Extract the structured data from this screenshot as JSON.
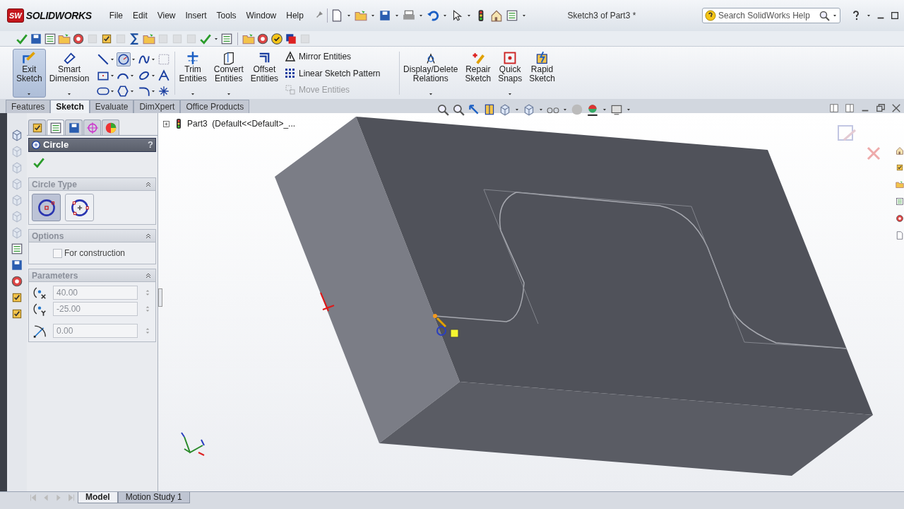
{
  "app": {
    "badge": "SW",
    "name": "SOLIDWORKS"
  },
  "menu": [
    "File",
    "Edit",
    "View",
    "Insert",
    "Tools",
    "Window",
    "Help"
  ],
  "window": {
    "title": "Sketch3 of Part3 *"
  },
  "search": {
    "placeholder": "Search SolidWorks Help"
  },
  "sketch_commands": [
    {
      "label": "Exit Sketch",
      "selected": true
    },
    {
      "label": "Smart Dimension",
      "selected": false
    }
  ],
  "edit_commands": [
    {
      "label": "Trim Entities"
    },
    {
      "label": "Convert Entities"
    },
    {
      "label": "Offset Entities"
    }
  ],
  "pattern_commands": [
    {
      "label": "Mirror Entities",
      "disabled": false
    },
    {
      "label": "Linear Sketch Pattern",
      "disabled": false
    },
    {
      "label": "Move Entities",
      "disabled": true
    }
  ],
  "relation_commands": [
    {
      "label": "Display/Delete Relations"
    },
    {
      "label": "Repair Sketch"
    },
    {
      "label": "Quick Snaps"
    },
    {
      "label": "Rapid Sketch"
    }
  ],
  "command_tabs": [
    {
      "label": "Features",
      "selected": false
    },
    {
      "label": "Sketch",
      "selected": true
    },
    {
      "label": "Evaluate",
      "selected": false
    },
    {
      "label": "DimXpert",
      "selected": false
    },
    {
      "label": "Office Products",
      "selected": false
    }
  ],
  "feature_tree": {
    "root": "Part3  (Default<<Default>_..."
  },
  "property_manager": {
    "title": "Circle",
    "help": "?",
    "circle_type": {
      "title": "Circle Type",
      "options": [
        {
          "kind": "center",
          "selected": true
        },
        {
          "kind": "perimeter",
          "selected": false
        }
      ]
    },
    "options": {
      "title": "Options",
      "for_construction": {
        "label": "For construction",
        "checked": false
      }
    },
    "parameters": {
      "title": "Parameters",
      "fields": [
        {
          "kind": "center-x",
          "value": "40.00"
        },
        {
          "kind": "center-y",
          "value": "-25.00"
        },
        {
          "kind": "radius",
          "value": "0.00"
        }
      ]
    }
  },
  "bottom_tabs": [
    {
      "label": "Model",
      "selected": true
    },
    {
      "label": "Motion Study 1",
      "selected": false
    }
  ]
}
